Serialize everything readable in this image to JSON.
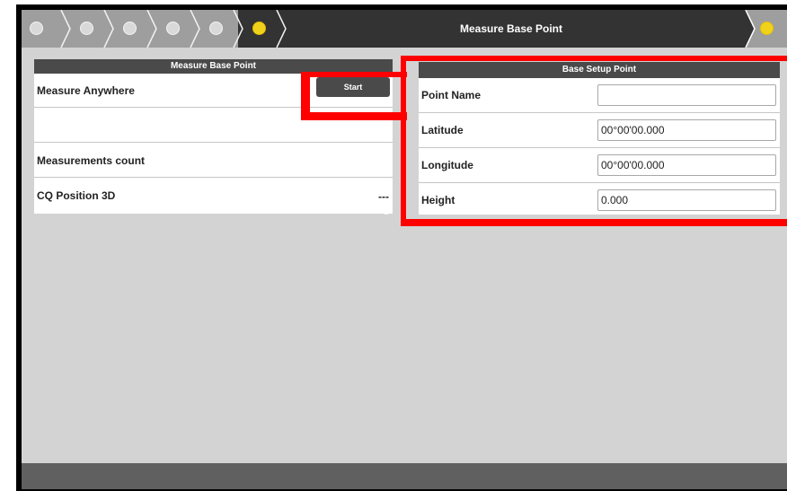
{
  "header": {
    "title": "Measure Base Point",
    "steps": [
      {
        "state": "idle"
      },
      {
        "state": "idle"
      },
      {
        "state": "idle"
      },
      {
        "state": "idle"
      },
      {
        "state": "idle"
      },
      {
        "state": "active"
      }
    ],
    "right_step_state": "active"
  },
  "left_panel": {
    "header": "Measure Base Point",
    "rows": {
      "measure_anywhere": "Measure Anywhere",
      "empty": "",
      "measurements_count": "Measurements count",
      "cq_position": "CQ Position 3D"
    },
    "start_button": "Start",
    "cq_value": "---"
  },
  "right_panel": {
    "header": "Base Setup Point",
    "fields": {
      "point_name": {
        "label": "Point Name",
        "value": ""
      },
      "latitude": {
        "label": "Latitude",
        "value": "00°00'00.000"
      },
      "longitude": {
        "label": "Longitude",
        "value": "00°00'00.000"
      },
      "height": {
        "label": "Height",
        "value": "0.000"
      }
    }
  },
  "colors": {
    "highlight": "#ff0000",
    "active_step": "#f1d21b",
    "header_bg": "#333333",
    "panel_header_bg": "#4a4a4a"
  }
}
